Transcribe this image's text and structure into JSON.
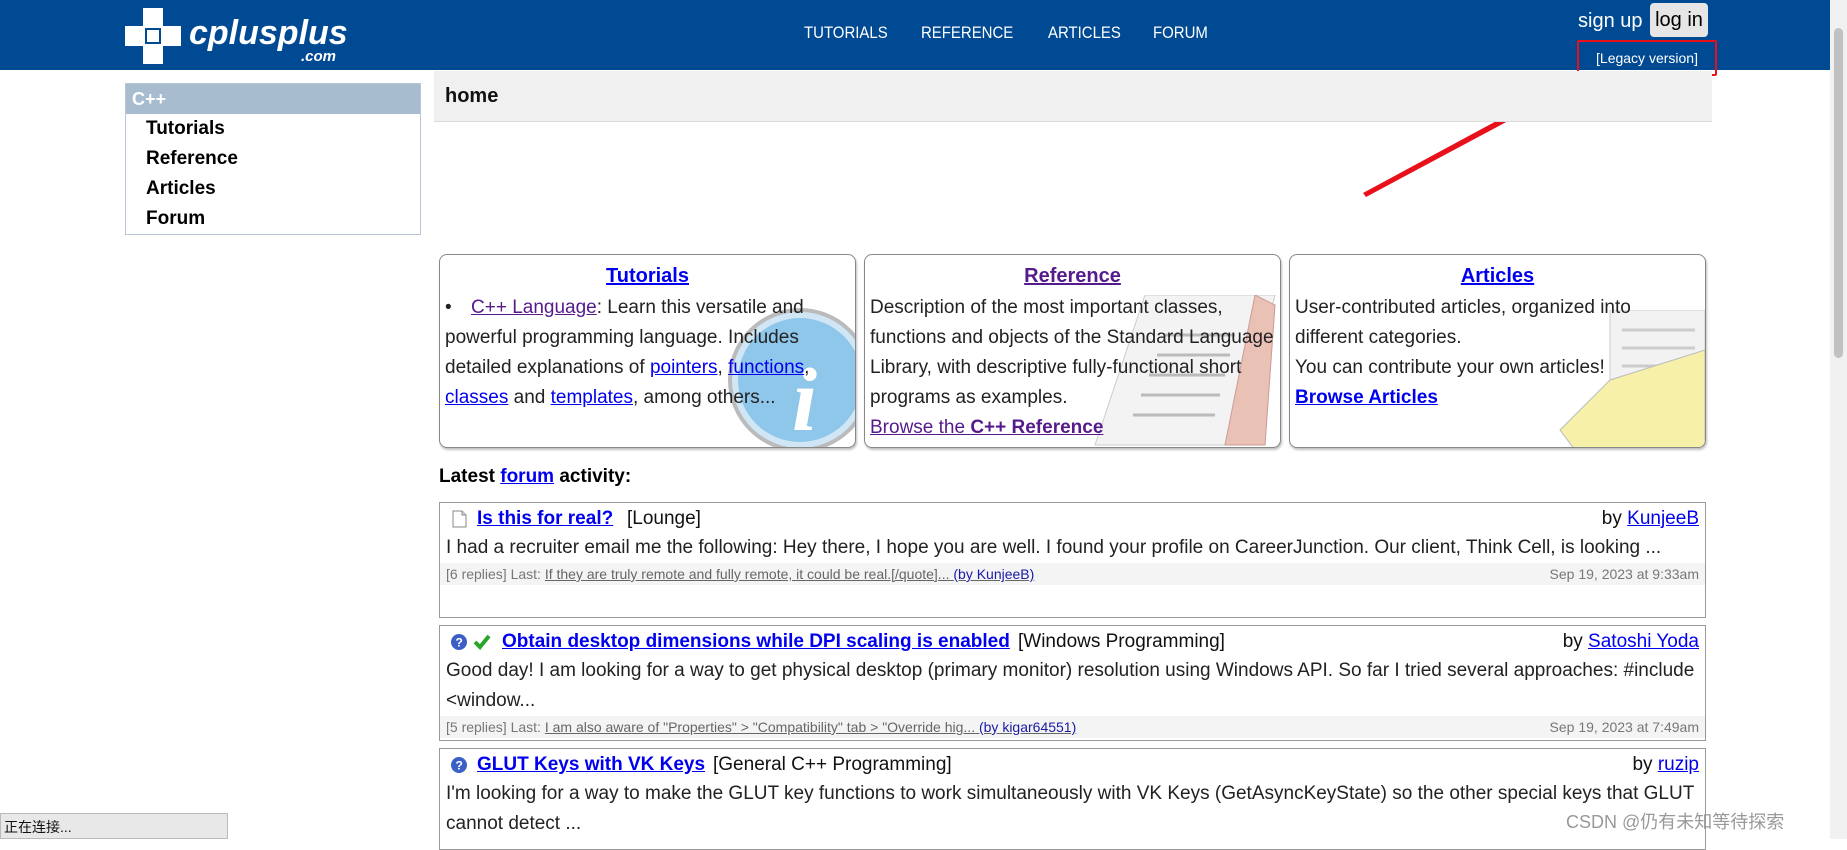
{
  "header": {
    "logo_text": "cplusplus",
    "logo_suffix": ".com",
    "nav": [
      "TUTORIALS",
      "REFERENCE",
      "ARTICLES",
      "FORUM"
    ],
    "signup": "sign up",
    "login": "log in",
    "legacy": "[Legacy version]"
  },
  "sidebar": {
    "title": "C++",
    "items": [
      "Tutorials",
      "Reference",
      "Articles",
      "Forum"
    ]
  },
  "breadcrumb": "home",
  "boxes": {
    "tutorials": {
      "title": "Tutorials",
      "link": "C++ Language",
      "text1": ": Learn this versatile and powerful programming language. Includes detailed explanations of ",
      "links": [
        "pointers",
        "functions",
        "classes",
        "templates"
      ],
      "sep_comma": ",",
      "sep_and": " and ",
      "text2": ", among others..."
    },
    "reference": {
      "title": "Reference",
      "text": "Description of the most important classes, functions and objects of the Standard Language Library, with descriptive fully-functional short programs as examples.",
      "browse_prefix": "Browse the ",
      "browse_bold": "C++ Reference"
    },
    "articles": {
      "title": "Articles",
      "text1": "User-contributed articles, organized into different categories.",
      "text2": "You can contribute your own articles!",
      "browse": "Browse Articles"
    }
  },
  "latest": {
    "prefix": "Latest ",
    "link": "forum",
    "suffix": " activity:"
  },
  "posts": [
    {
      "title": "Is this for real?",
      "category": "[Lounge]",
      "by_prefix": "by ",
      "author": "KunjeeB",
      "text": "I had a recruiter email me the following: Hey there, I hope you are well. I found your profile on CareerJunction. Our client, Think Cell, is looking ...",
      "replies": "[6 replies] Last: ",
      "last": "If they are truly remote and fully remote, it could be real.[/quote]...",
      "last_user": "(by KunjeeB)",
      "date": "Sep 19, 2023 at 9:33am",
      "icon": "document-icon"
    },
    {
      "title": "Obtain desktop dimensions while DPI scaling is enabled",
      "category": "[Windows Programming]",
      "by_prefix": "by ",
      "author": "Satoshi Yoda",
      "text": "Good day! I am looking for a way to get physical desktop (primary monitor) resolution using Windows API. So far I tried several approaches: #include <window...",
      "replies": "[5 replies] Last: ",
      "last": "I am also aware of \"Properties\" > \"Compatibility\" tab > \"Override hig...",
      "last_user": "(by kigar64551)",
      "date": "Sep 19, 2023 at 7:49am",
      "icon": "question-check-icon"
    },
    {
      "title": "GLUT Keys with VK Keys",
      "category": "[General C++ Programming]",
      "by_prefix": "by ",
      "author": "ruzip",
      "text": "I'm looking for a way to make the GLUT key functions to work simultaneously with VK Keys (GetAsyncKeyState) so the other special keys that GLUT cannot detect ...",
      "icon": "question-icon"
    }
  ],
  "statusbar": "正在连接...",
  "watermark": "CSDN @仍有未知等待探索",
  "colors": {
    "header_bg": "#004a94",
    "sidebar_head": "#a8bccf",
    "highlight_red": "#e8101b",
    "link": "#0000ee",
    "visited": "#551a8b"
  }
}
